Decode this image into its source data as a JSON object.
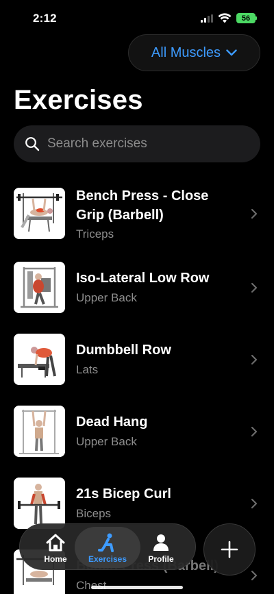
{
  "status_bar": {
    "time": "2:12",
    "battery": "56"
  },
  "filter": {
    "label": "All Muscles"
  },
  "title": "Exercises",
  "search": {
    "placeholder": "Search exercises",
    "value": ""
  },
  "exercises": [
    {
      "name": "Bench Press - Close Grip (Barbell)",
      "muscle": "Triceps"
    },
    {
      "name": "Iso-Lateral Low Row",
      "muscle": "Upper Back"
    },
    {
      "name": "Dumbbell Row",
      "muscle": "Lats"
    },
    {
      "name": "Dead Hang",
      "muscle": "Upper Back"
    },
    {
      "name": "21s Bicep Curl",
      "muscle": "Biceps"
    },
    {
      "name": "Bench Press (Barbell)",
      "muscle": "Chest"
    }
  ],
  "tabs": [
    {
      "label": "Home",
      "icon": "house-icon"
    },
    {
      "label": "Exercises",
      "icon": "exercise-figure-icon",
      "active": true
    },
    {
      "label": "Profile",
      "icon": "person-icon"
    }
  ],
  "fab": {
    "icon": "plus-icon"
  },
  "colors": {
    "accent": "#3d9bff",
    "battery": "#4cd964",
    "background": "#000000"
  }
}
